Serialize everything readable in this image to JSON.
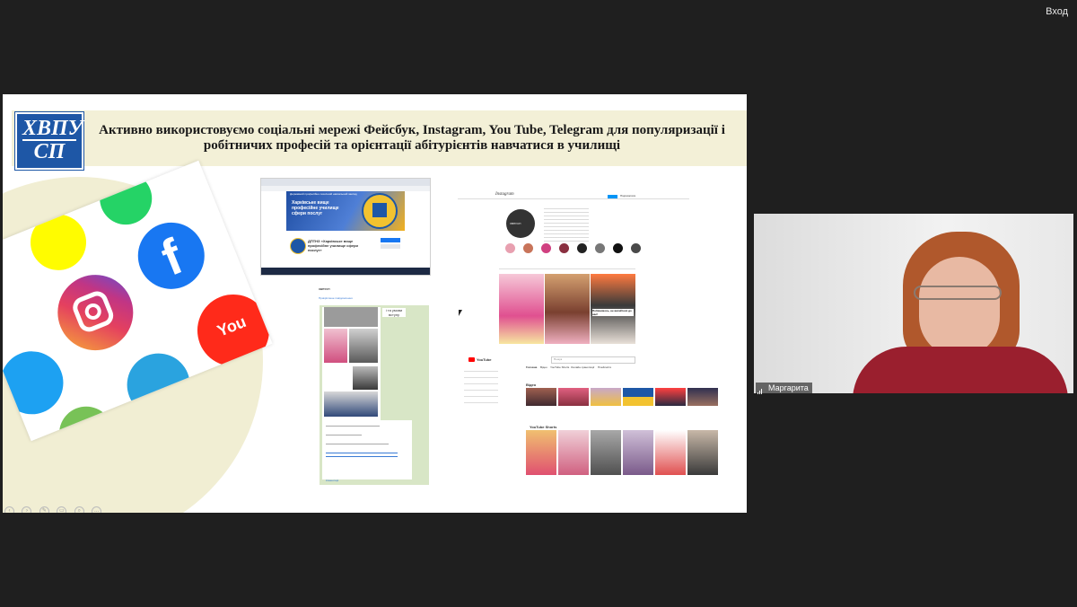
{
  "topbar": {
    "login_label": "Вход"
  },
  "slide": {
    "logo_top": "ХВПУ",
    "logo_bottom": "СП",
    "title": "Активно використовуємо соціальні мережі  Фейсбук, Instagram, You Tube, Telegram для популяризації і робітничих професій та орієнтації абітурієнтів навчатися в училищі"
  },
  "social_icons": {
    "youtube_text": "You"
  },
  "facebook_shot": {
    "banner_text": "Харківське вище професійне училище сфери послуг",
    "page_name": "ДПТНЗ «Харківське вище професійне училище сфери послуг»",
    "header_text": "Державний професійно-технічний навчальний заклад"
  },
  "instagram_shot": {
    "brand": "Instagram",
    "avatar_label": "ХВПУСП",
    "follow_label": "Підписатися",
    "banner_text": "Побачимось, не вагайтеся до нас!"
  },
  "telegram_shot": {
    "channel": "ХВПУСП",
    "pinned": "Прикріплене повідомлення",
    "bubble": "і та умови вступу",
    "footer_label": "Коментарі"
  },
  "youtube_shot": {
    "brand": "YouTube",
    "search_placeholder": "Пошук",
    "tabs": [
      "Головна",
      "Відео",
      "YouTube Shorts",
      "Онлайн-трансляції",
      "Плейлисти"
    ],
    "section_videos": "Відео",
    "section_shorts": "YouTube Shorts"
  },
  "webcam": {
    "participant_name": "Маргарита"
  },
  "colors": {
    "background": "#1f1f1f",
    "title_bar": "#f3f0d7",
    "logo_blue": "#1e57a6",
    "circle": "#f1eed3"
  }
}
